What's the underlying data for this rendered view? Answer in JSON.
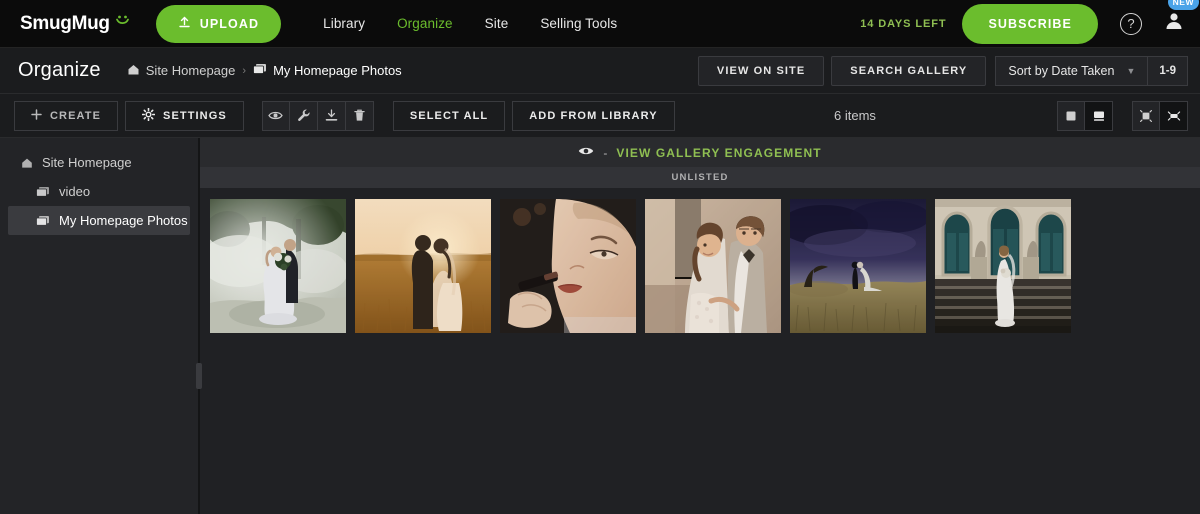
{
  "topnav": {
    "logo": "SmugMug",
    "logo_smile_icon": "smile-icon",
    "upload_label": "UPLOAD",
    "upload_icon": "upload-arrow-icon",
    "links": [
      {
        "label": "Library",
        "active": false
      },
      {
        "label": "Organize",
        "active": true
      },
      {
        "label": "Site",
        "active": false
      },
      {
        "label": "Selling Tools",
        "active": false
      }
    ],
    "days_left": "14 DAYS LEFT",
    "subscribe_label": "SUBSCRIBE",
    "help_icon": "question-mark-icon",
    "avatar_icon": "user-avatar-icon",
    "new_badge": "NEW",
    "accent_green": "#6bbd2d",
    "badge_blue": "#4aa3e8"
  },
  "crumbbar": {
    "page_title": "Organize",
    "crumbs": [
      {
        "label": "Site Homepage",
        "icon": "home-icon"
      },
      {
        "label": "My Homepage Photos",
        "icon": "gallery-icon"
      }
    ],
    "separator": "›",
    "view_on_site": "VIEW ON SITE",
    "search_gallery": "SEARCH GALLERY",
    "sort_value": "Sort by Date Taken",
    "sort_chevron_icon": "chevron-down-icon",
    "range_label": "1-9"
  },
  "toolbar": {
    "create_label": "CREATE",
    "create_icon": "plus-icon",
    "settings_label": "SETTINGS",
    "settings_icon": "gear-icon",
    "icon_buttons": [
      {
        "name": "eye-icon",
        "glyph": "◉"
      },
      {
        "name": "wrench-icon",
        "glyph": "⚒"
      },
      {
        "name": "download-icon",
        "glyph": "⬇"
      },
      {
        "name": "trash-icon",
        "glyph": "Ὕ1"
      }
    ],
    "select_all": "SELECT ALL",
    "add_from_library": "ADD FROM LIBRARY",
    "items_count": "6 items",
    "view_toggles": [
      {
        "name": "grid-view-icon",
        "selected": false
      },
      {
        "name": "detail-view-icon",
        "selected": true
      },
      {
        "name": "small-thumb-icon",
        "selected": false
      },
      {
        "name": "large-thumb-icon",
        "selected": true
      }
    ]
  },
  "sidebar": {
    "items": [
      {
        "label": "Site Homepage",
        "icon": "home-icon",
        "level": 0,
        "selected": false
      },
      {
        "label": "video",
        "icon": "gallery-icon",
        "level": 1,
        "selected": false
      },
      {
        "label": "My Homepage Photos",
        "icon": "gallery-icon",
        "level": 1,
        "selected": true
      }
    ]
  },
  "content": {
    "engagement_eye_icon": "eye-icon",
    "engagement_value": "-",
    "engagement_label": "VIEW GALLERY ENGAGEMENT",
    "engagement_color": "#8fbf52",
    "unlisted_label": "UNLISTED",
    "photos": [
      {
        "name": "bride-groom-misty-forest",
        "width": 136,
        "alt": "Bride and groom embracing in misty forest"
      },
      {
        "name": "couple-sunset-field",
        "width": 136,
        "alt": "Couple kissing at golden sunset in field"
      },
      {
        "name": "bridal-makeup-closeup",
        "width": 136,
        "alt": "Close-up of bridal makeup lipstick application"
      },
      {
        "name": "couple-portrait-warm",
        "width": 136,
        "alt": "Smiling bride and groom portrait"
      },
      {
        "name": "couple-stormy-sky",
        "width": 136,
        "alt": "Couple in field under dramatic stormy sky"
      },
      {
        "name": "bride-palace-steps",
        "width": 136,
        "alt": "Bride standing on grand palace steps"
      }
    ]
  }
}
